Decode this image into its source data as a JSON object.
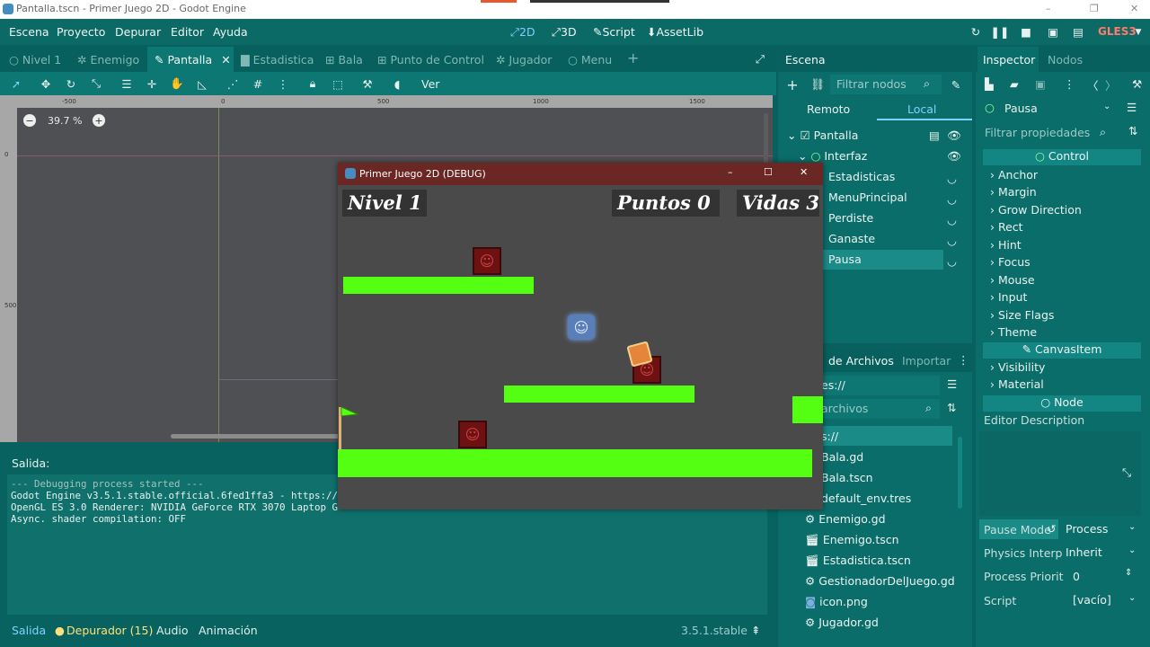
{
  "window": {
    "title": "Pantalla.tscn - Primer Juego 2D - Godot Engine"
  },
  "menu": [
    "Escena",
    "Proyecto",
    "Depurar",
    "Editor",
    "Ayuda"
  ],
  "modes": [
    "2D",
    "3D",
    "Script",
    "AssetLib"
  ],
  "renderer": "GLES3",
  "scene_tabs": [
    "Nivel 1",
    "Enemigo",
    "Pantalla",
    "Estadistica",
    "Bala",
    "Punto de Control",
    "Jugador",
    "Menu"
  ],
  "toolbar": {
    "view_label": "Ver"
  },
  "viewport": {
    "zoom": "39.7 %",
    "ruler_ticks": [
      "-500",
      "0",
      "500",
      "1000",
      "1500"
    ],
    "vruler_ticks": [
      "0",
      "500"
    ]
  },
  "game": {
    "title": "Primer Juego 2D (DEBUG)",
    "hud": {
      "level": "Nivel 1",
      "points": "Puntos 0",
      "lives": "Vidas 3"
    }
  },
  "output": {
    "title": "Salida:",
    "lines": [
      "--- Debugging process started ---",
      "Godot Engine v3.5.1.stable.official.6fed1ffa3 - https://",
      "OpenGL ES 3.0 Renderer: NVIDIA GeForce RTX 3070 Laptop G",
      "Async. shader compilation: OFF"
    ]
  },
  "bottom_tabs": {
    "salida": "Salida",
    "depurador": "Depurador (15)",
    "audio": "Audio",
    "animacion": "Animación"
  },
  "version": "3.5.1.stable",
  "scene_dock": {
    "title": "Escena",
    "filter_placeholder": "Filtrar nodos",
    "remote": "Remoto",
    "local": "Local",
    "tree": [
      "Pantalla",
      "Interfaz",
      "Estadisticas",
      "MenuPrincipal",
      "Perdiste",
      "Ganaste",
      "Pausa"
    ]
  },
  "files_dock": {
    "title": "de Archivos",
    "import": "Importar",
    "path": "es://",
    "filter_placeholder": "archivos",
    "items": [
      "s://",
      "Bala.gd",
      "Bala.tscn",
      "default_env.tres",
      "Enemigo.gd",
      "Enemigo.tscn",
      "Estadistica.tscn",
      "GestionadorDelJuego.gd",
      "icon.png",
      "Jugador.gd"
    ]
  },
  "inspector": {
    "title": "Inspector",
    "nodes_tab": "Nodos",
    "object": "Pausa",
    "filter_placeholder": "Filtrar propiedades",
    "section_control": "Control",
    "props": [
      "Anchor",
      "Margin",
      "Grow Direction",
      "Rect",
      "Hint",
      "Focus",
      "Mouse",
      "Input",
      "Size Flags",
      "Theme"
    ],
    "section_canvas": "CanvasItem",
    "canvas_props": [
      "Visibility",
      "Material"
    ],
    "section_node": "Node",
    "editor_description": "Editor Description",
    "pause_mode_label": "Pause Mode",
    "pause_mode_value": "Process",
    "physics_label": "Physics Interp",
    "physics_value": "Inherit",
    "priority_label": "Process Priorit",
    "priority_value": "0",
    "script_label": "Script",
    "script_value": "[vacío]"
  },
  "colors": {
    "accent": "#0b6d69",
    "platform": "#55ff12",
    "game_titlebar": "#6b2724"
  }
}
